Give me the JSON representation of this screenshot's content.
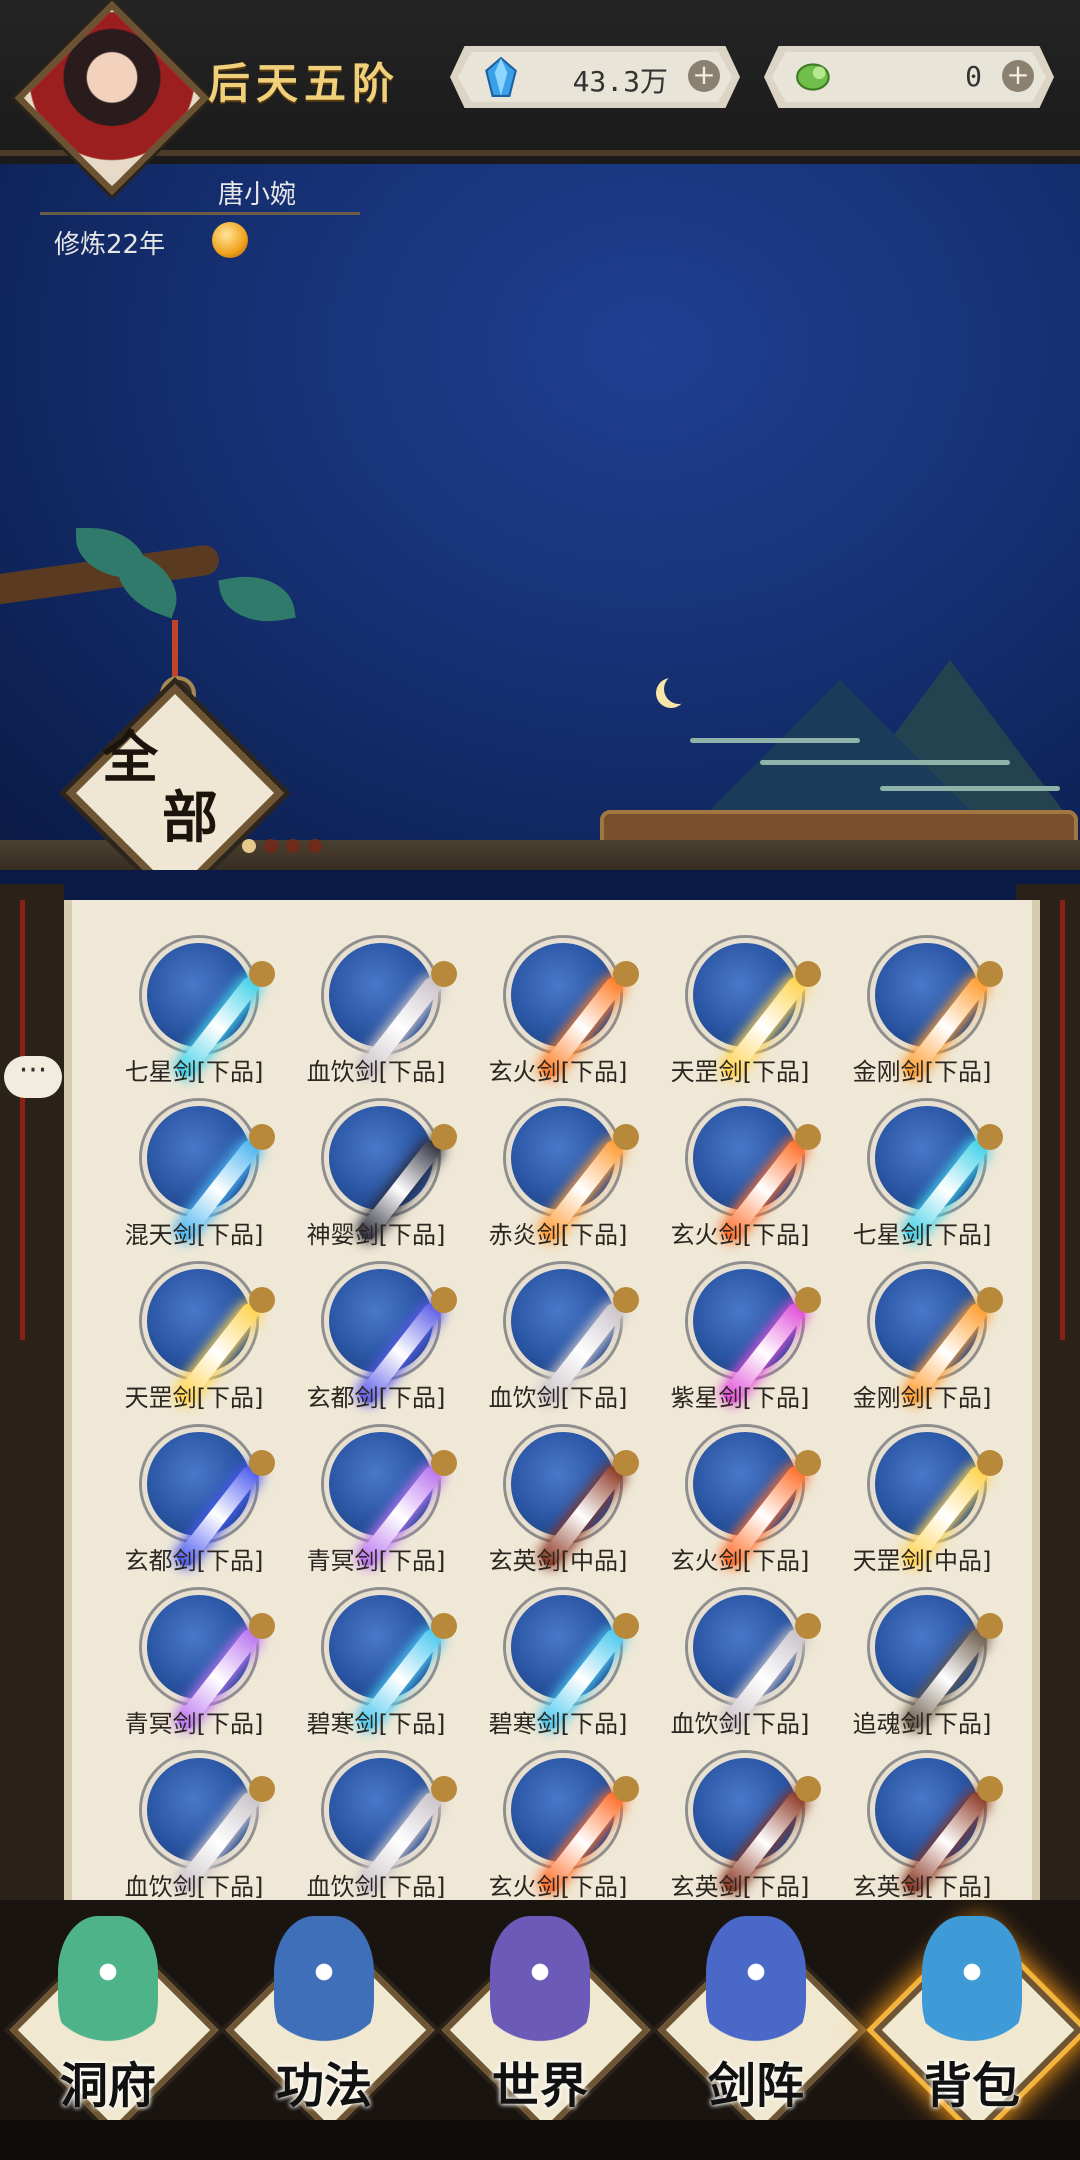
{
  "header": {
    "realm": "后天五阶",
    "player_name": "唐小婉",
    "cultivation": "修炼22年"
  },
  "resources": [
    {
      "name": "spirit-crystal",
      "value": "43.3万",
      "plus": "+",
      "color": "#3aa0e8"
    },
    {
      "name": "jade",
      "value": "0",
      "plus": "+",
      "color": "#6fbf4a"
    }
  ],
  "filter": {
    "label_top": "全",
    "label_bottom": "部",
    "page_dots": 4,
    "active_dot": 0
  },
  "chat": {
    "label": "···"
  },
  "inventory": {
    "items": [
      {
        "label": "七星剑[下品]",
        "color": "#3fd0e8"
      },
      {
        "label": "血饮剑[下品]",
        "color": "#c9c2c8"
      },
      {
        "label": "玄火剑[下品]",
        "color": "#ff7a20"
      },
      {
        "label": "天罡剑[下品]",
        "color": "#ffd24a"
      },
      {
        "label": "金刚剑[下品]",
        "color": "#ff9a28"
      },
      {
        "label": "混天剑[下品]",
        "color": "#48b4f0"
      },
      {
        "label": "神婴剑[下品]",
        "color": "#2b2b3a"
      },
      {
        "label": "赤炎剑[下品]",
        "color": "#ff9a30"
      },
      {
        "label": "玄火剑[下品]",
        "color": "#ff6a24"
      },
      {
        "label": "七星剑[下品]",
        "color": "#3fd0e8"
      },
      {
        "label": "天罡剑[下品]",
        "color": "#ffd24a"
      },
      {
        "label": "玄都剑[下品]",
        "color": "#5a5ae8"
      },
      {
        "label": "血饮剑[下品]",
        "color": "#c9c2c8"
      },
      {
        "label": "紫星剑[下品]",
        "color": "#e04ad8"
      },
      {
        "label": "金刚剑[下品]",
        "color": "#ff9a28"
      },
      {
        "label": "玄都剑[下品]",
        "color": "#4a58f0"
      },
      {
        "label": "青冥剑[下品]",
        "color": "#b870f0"
      },
      {
        "label": "玄英剑[中品]",
        "color": "#8a3420"
      },
      {
        "label": "玄火剑[下品]",
        "color": "#ff6a24"
      },
      {
        "label": "天罡剑[中品]",
        "color": "#ffd24a"
      },
      {
        "label": "青冥剑[下品]",
        "color": "#b870f0"
      },
      {
        "label": "碧寒剑[下品]",
        "color": "#48c8f0"
      },
      {
        "label": "碧寒剑[下品]",
        "color": "#48c8f0"
      },
      {
        "label": "血饮剑[下品]",
        "color": "#c9c2c8"
      },
      {
        "label": "追魂剑[下品]",
        "color": "#6a5a48"
      },
      {
        "label": "血饮剑[下品]",
        "color": "#c9c2c8"
      },
      {
        "label": "血饮剑[下品]",
        "color": "#c9c2c8"
      },
      {
        "label": "玄火剑[下品]",
        "color": "#ff6a24"
      },
      {
        "label": "玄英剑[下品]",
        "color": "#8a3420"
      },
      {
        "label": "玄英剑[下品]",
        "color": "#8a3420"
      }
    ]
  },
  "nav": [
    {
      "label": "洞府",
      "icon": "cave-residence-icon",
      "color": "#4fb38a",
      "active": false
    },
    {
      "label": "功法",
      "icon": "technique-book-icon",
      "color": "#3e6fb8",
      "active": false
    },
    {
      "label": "世界",
      "icon": "world-scroll-icon",
      "color": "#6b5ab8",
      "active": false
    },
    {
      "label": "剑阵",
      "icon": "sword-formation-icon",
      "color": "#4a68c8",
      "active": false
    },
    {
      "label": "背包",
      "icon": "backpack-bag-icon",
      "color": "#3f9ad8",
      "active": true
    }
  ]
}
